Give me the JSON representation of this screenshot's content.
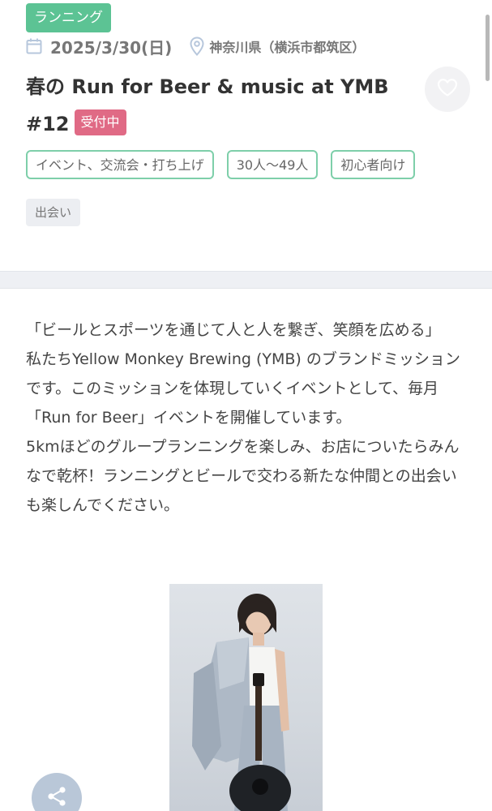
{
  "event": {
    "category": "ランニング",
    "date": "2025/3/30(日)",
    "location": "神奈川県（横浜市都筑区）",
    "title": "春の Run for Beer & music at YMB #12",
    "status": "受付中",
    "tags": [
      "イベント、交流会・打ち上げ",
      "30人〜49人",
      "初心者向け"
    ],
    "keyword_tag": "出会い",
    "description": [
      "「ビールとスポーツを通じて人と人を繋ぎ、笑顔を広める」",
      "私たちYellow Monkey Brewing (YMB) のブランドミッションです。このミッションを体現していくイベントとして、毎月「Run for Beer」イベントを開催しています。",
      "5kmほどのグループランニングを楽しみ、お店についたらみんなで乾杯！ランニングとビールで交わる新たな仲間との出会いも楽しんでください。"
    ]
  },
  "icons": {
    "date": "calendar-icon",
    "location": "map-pin-icon",
    "favorite": "heart-icon",
    "share": "share-icon"
  },
  "colors": {
    "category_green": "#5cc394",
    "status_pink": "#e06a85",
    "tag_border": "#7ecfaa",
    "share_bg": "#b9c7d8"
  }
}
